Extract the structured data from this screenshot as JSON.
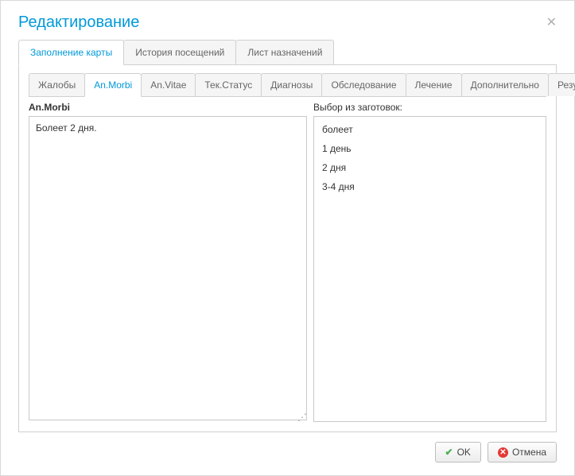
{
  "dialog": {
    "title": "Редактирование"
  },
  "outerTabs": [
    {
      "label": "Заполнение карты",
      "active": true
    },
    {
      "label": "История посещений",
      "active": false
    },
    {
      "label": "Лист назначений",
      "active": false
    }
  ],
  "innerTabs": [
    {
      "label": "Жалобы",
      "active": false
    },
    {
      "label": "An.Morbi",
      "active": true
    },
    {
      "label": "An.Vitae",
      "active": false
    },
    {
      "label": "Тек.Статус",
      "active": false
    },
    {
      "label": "Диагнозы",
      "active": false
    },
    {
      "label": "Обследование",
      "active": false
    },
    {
      "label": "Лечение",
      "active": false
    },
    {
      "label": "Дополнительно",
      "active": false
    },
    {
      "label": "Результат",
      "active": false
    }
  ],
  "leftPanel": {
    "label": "An.Morbi",
    "value": "Болеет 2 дня."
  },
  "rightPanel": {
    "label": "Выбор из заготовок:",
    "items": [
      "болеет",
      "1 день",
      "2 дня",
      "3-4 дня"
    ]
  },
  "buttons": {
    "ok": "OK",
    "cancel": "Отмена"
  }
}
